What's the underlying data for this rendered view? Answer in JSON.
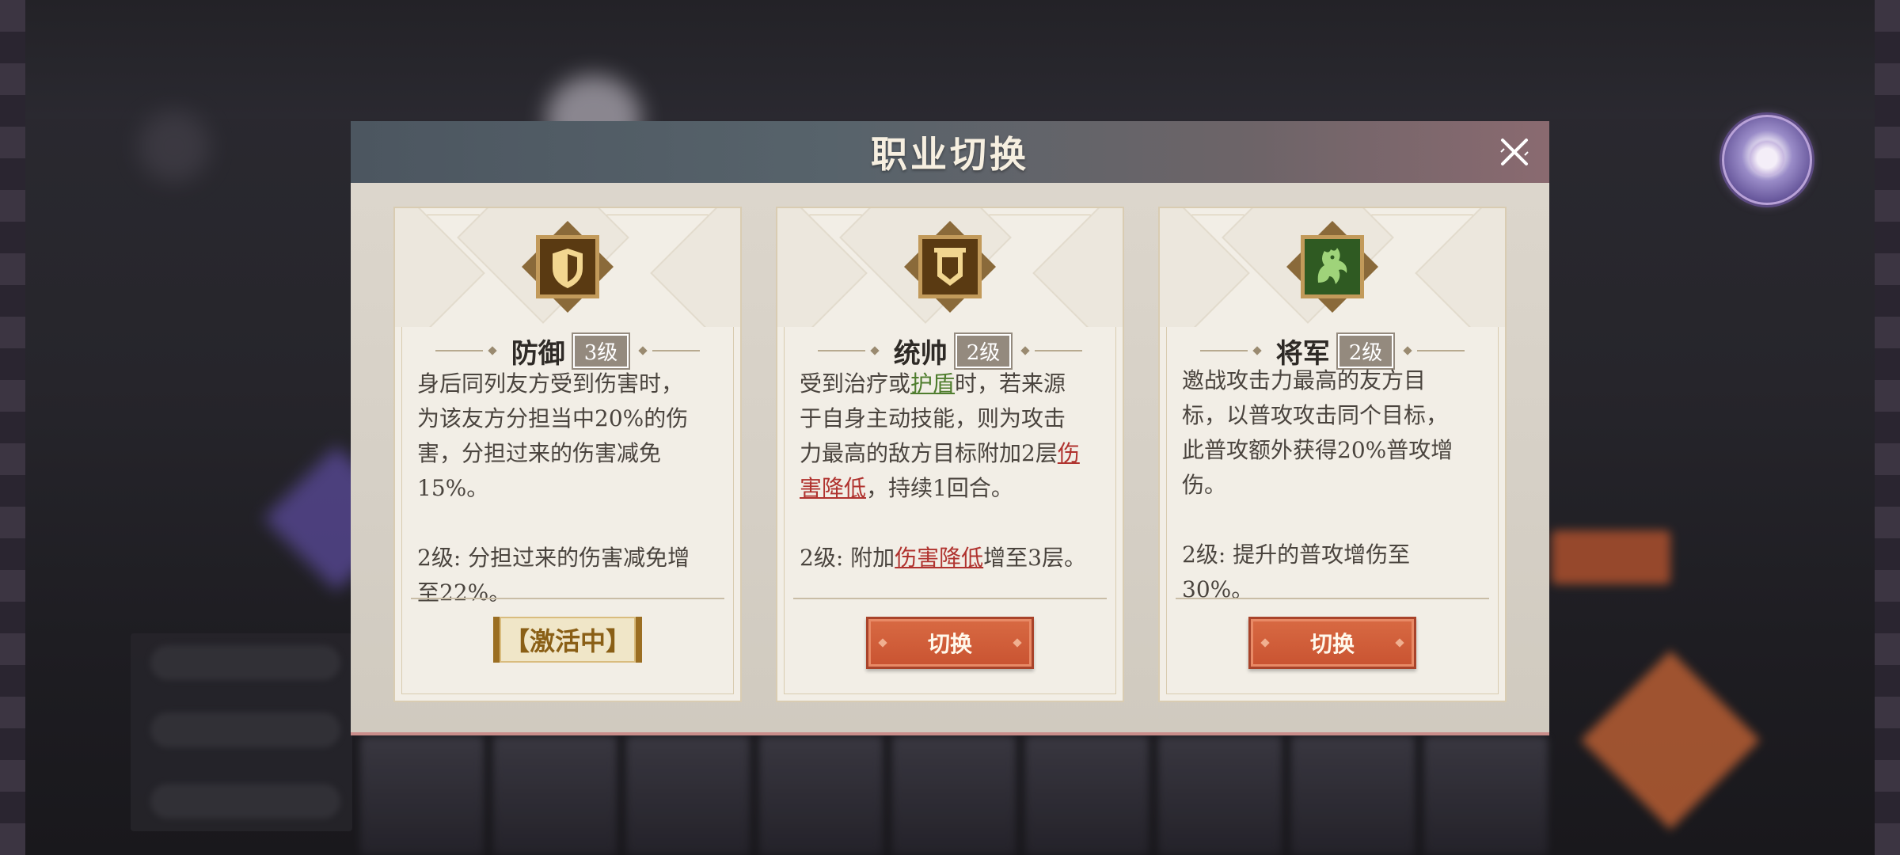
{
  "dialog": {
    "title": "职业切换",
    "close_icon": "close-icon"
  },
  "cards": [
    {
      "icon": "shield-icon",
      "icon_bg": "#5a3a12",
      "name": "防御",
      "level": "3级",
      "desc": [
        "身后同列友方受到伤害时，",
        "为该友方分担当中20%的伤",
        "害，分担过来的伤害减免",
        "15%。"
      ],
      "upgrade": [
        "2级: 分担过来的伤害减免增",
        "至22%。"
      ],
      "status": "【激活中】"
    },
    {
      "icon": "banner-icon",
      "icon_bg": "#5a3a12",
      "name": "统帅",
      "level": "2级",
      "desc_parts": {
        "l1a": "受到治疗或",
        "l1kw": "护盾",
        "l1b": "时，若来源",
        "l2": "于自身主动技能，则为攻击",
        "l3a": "力最高的敌方目标附加2层",
        "l3kw": "伤",
        "l4kw": "害降低",
        "l4b": "，持续1回合。",
        "up_a": "2级: 附加",
        "up_kw": "伤害降低",
        "up_b": "增至3层。"
      },
      "button": "切换"
    },
    {
      "icon": "dragon-icon",
      "icon_bg": "#2f5a22",
      "name": "将军",
      "level": "2级",
      "desc": [
        "邀战攻击力最高的友方目",
        "标，以普攻攻击同个目标，",
        "此普攻额外获得20%普攻增",
        "伤。"
      ],
      "upgrade": [
        "2级: 提升的普攻增伤至",
        "30%。"
      ],
      "button": "切换"
    }
  ],
  "colors": {
    "accent_button": "#c95331",
    "keyword_green": "#4f7d2e",
    "keyword_red": "#b0332f",
    "active_tag": "#8a5f16"
  }
}
